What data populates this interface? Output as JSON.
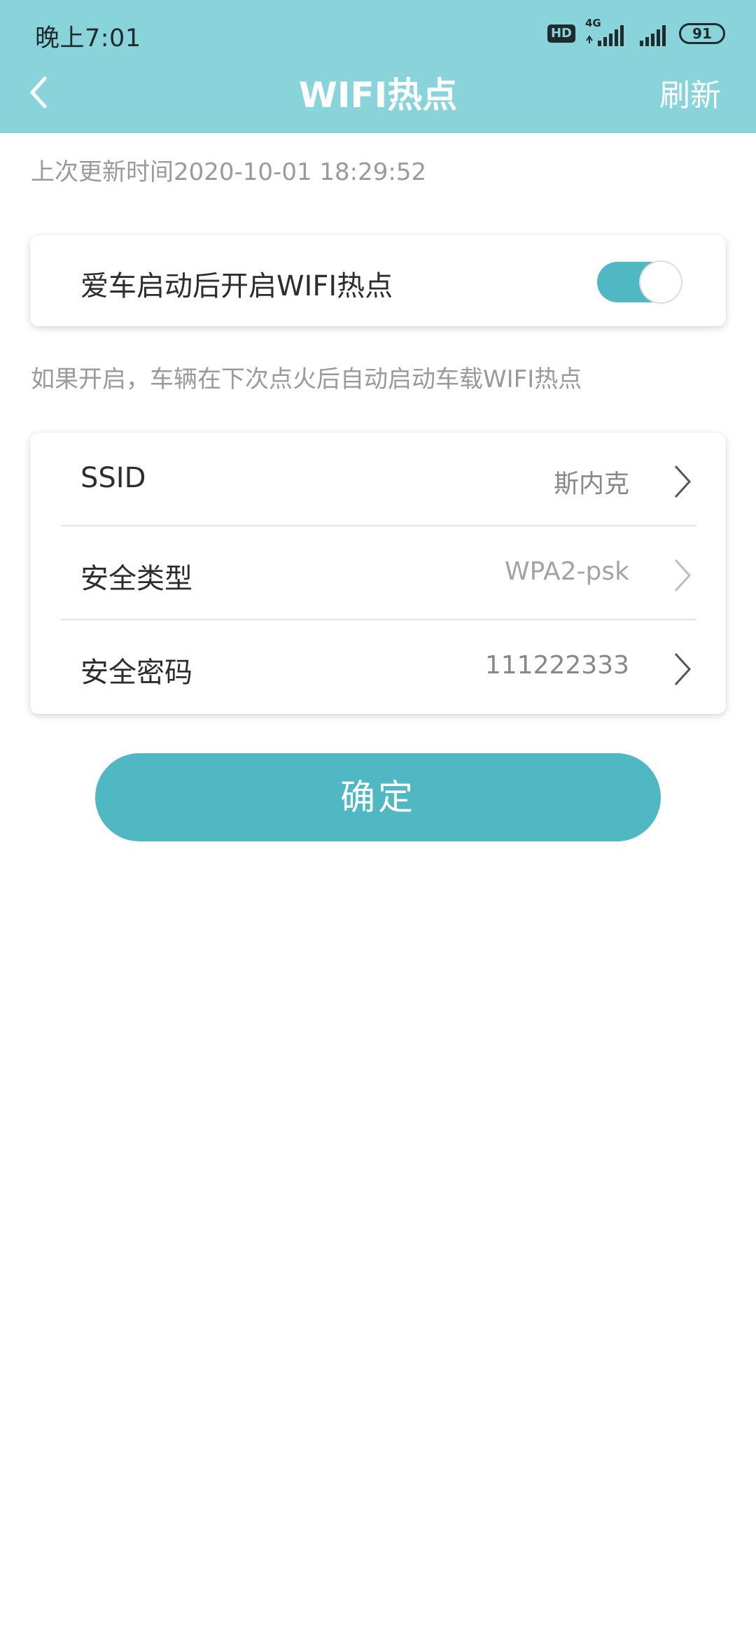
{
  "status_bar": {
    "time": "晚上7:01",
    "hd_badge": "HD",
    "network_type": "4G",
    "battery": "91",
    "icons": [
      "hd-icon",
      "signal-4g-icon",
      "signal-icon",
      "battery-icon"
    ]
  },
  "nav": {
    "back_icon": "chevron-left-icon",
    "title": "WIFI热点",
    "refresh_label": "刷新"
  },
  "last_update": "上次更新时间2020-10-01 18:29:52",
  "auto_hotspot": {
    "label": "爱车启动后开启WIFI热点",
    "enabled": true
  },
  "hint": "如果开启，车辆在下次点火后自动启动车载WIFI热点",
  "settings": [
    {
      "label": "SSID",
      "value": "斯内克",
      "icon": "chevron-right-icon"
    },
    {
      "label": "安全类型",
      "value": "WPA2-psk",
      "icon": "chevron-right-icon"
    },
    {
      "label": "安全密码",
      "value": "111222333",
      "icon": "chevron-right-icon"
    }
  ],
  "confirm_label": "确定",
  "colors": {
    "header_bg": "#89d4da",
    "accent": "#4fb8c2",
    "muted_text": "#9a9a9a",
    "primary_text": "#2d2d2d"
  }
}
